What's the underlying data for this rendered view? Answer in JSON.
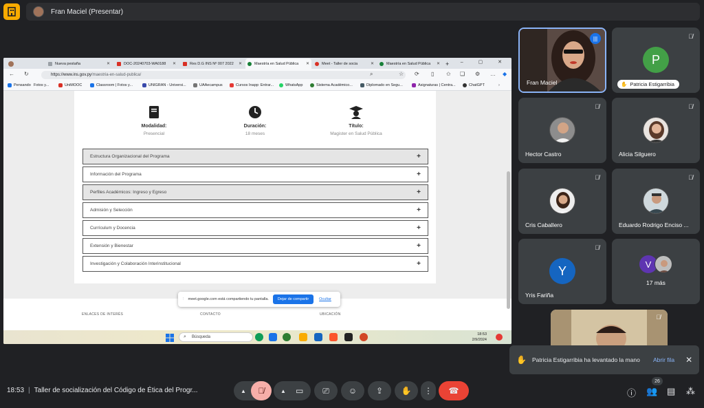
{
  "topbar": {
    "presenter_label": "Fran Maciel (Presentar)"
  },
  "browser": {
    "tabs": [
      {
        "label": "Nueva pestaña",
        "favicon_color": "#9aa0a6"
      },
      {
        "label": "DOC-20240703-WA0188",
        "favicon_color": "#d93025"
      },
      {
        "label": "Res D.G INS Nº 007 2022",
        "favicon_color": "#d93025"
      },
      {
        "label": "Maestría en Salud Pública",
        "favicon_color": "#188038"
      },
      {
        "label": "Meet - Taller de socia",
        "favicon_color": "#d93025"
      },
      {
        "label": "Maestría en Salud Pública",
        "favicon_color": "#188038"
      }
    ],
    "url_domain": "https://www.ins.gov.py",
    "url_path": "/maestria-en-salud-publica/",
    "bookmarks": [
      "Pensando",
      "Fotos y...",
      "UniMOOC",
      "Classroom | Fotos y...",
      "UNIGRAN - Universi...",
      "UAAecampus",
      "Cursos Inapp: Entrar...",
      "WhatsApp",
      "Sistema Académico...",
      "Diplomado en Segu...",
      "Asignaturas | Centra...",
      "ChatGPT"
    ]
  },
  "webpage": {
    "features": [
      {
        "title": "Modalidad:",
        "value": "Presencial",
        "icon": "book-icon"
      },
      {
        "title": "Duración:",
        "value": "18 meses",
        "icon": "clock-icon"
      },
      {
        "title": "Título:",
        "value": "Magister en Salud Pública",
        "icon": "graduate-icon"
      }
    ],
    "accordion": [
      "Estructura Organizacional del Programa",
      "Información del Programa",
      "Perfiles Académicos: Ingreso y Egreso",
      "Admisión y Selección",
      "Currículum y Docencia",
      "Extensión y Bienestar",
      "Investigación y Colaboración Interinstitucional"
    ],
    "footer": [
      "ENLACES DE INTERÉS",
      "CONTACTO",
      "UBICACIÓN"
    ],
    "share_banner": {
      "text": "meet.google.com está compartiendo tu pantalla.",
      "stop_label": "Dejar de compartir",
      "hide_label": "Ocultar"
    }
  },
  "taskbar": {
    "search_placeholder": "Búsqueda",
    "time": "18:53",
    "date": "2/9/2024"
  },
  "participants": [
    {
      "name": "Fran Maciel"
    },
    {
      "name": "Patricia Estigarribia",
      "initial": "P",
      "color": "#43a047"
    },
    {
      "name": "Hector Castro"
    },
    {
      "name": "Alicia Silguero"
    },
    {
      "name": "Cris Caballero"
    },
    {
      "name": "Eduardo Rodrigo Enciso ..."
    },
    {
      "name": "Yris Fariña",
      "initial": "Y",
      "color": "#1565c0"
    },
    {
      "name": "17 más",
      "initial": "V",
      "color": "#5e35b1"
    }
  ],
  "toast": {
    "text": "Patricia Estigarribia ha levantado la mano",
    "action": "Abrir fila"
  },
  "bottombar": {
    "time": "18:53",
    "meeting_title": "Taller de socialización del Código de Ética del Progr...",
    "people_count": "26"
  }
}
